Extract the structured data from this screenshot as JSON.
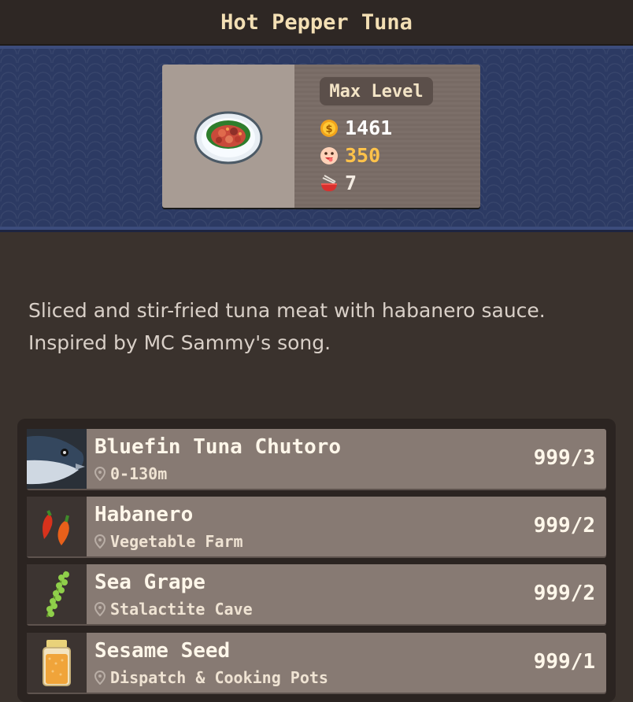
{
  "header": {
    "title": "Hot Pepper Tuna"
  },
  "recipe": {
    "level_label": "Max Level",
    "price": "1461",
    "taste": "350",
    "servings": "7",
    "description_line1": "Sliced and stir-fried tuna meat with habanero sauce.",
    "description_line2": "Inspired by MC Sammy's song."
  },
  "colors": {
    "price": "#ffffff",
    "taste": "#ffc24a",
    "servings": "#f3ebe2",
    "accent_banner": "#2c3a63"
  },
  "ingredients": [
    {
      "name": "Bluefin Tuna Chutoro",
      "location": "0-130m",
      "count": "999/3",
      "icon": "tuna-icon"
    },
    {
      "name": "Habanero",
      "location": "Vegetable Farm",
      "count": "999/2",
      "icon": "habanero-icon"
    },
    {
      "name": "Sea Grape",
      "location": "Stalactite Cave",
      "count": "999/2",
      "icon": "sea-grape-icon"
    },
    {
      "name": "Sesame Seed",
      "location": "Dispatch & Cooking Pots",
      "count": "999/1",
      "icon": "sesame-jar-icon"
    }
  ]
}
